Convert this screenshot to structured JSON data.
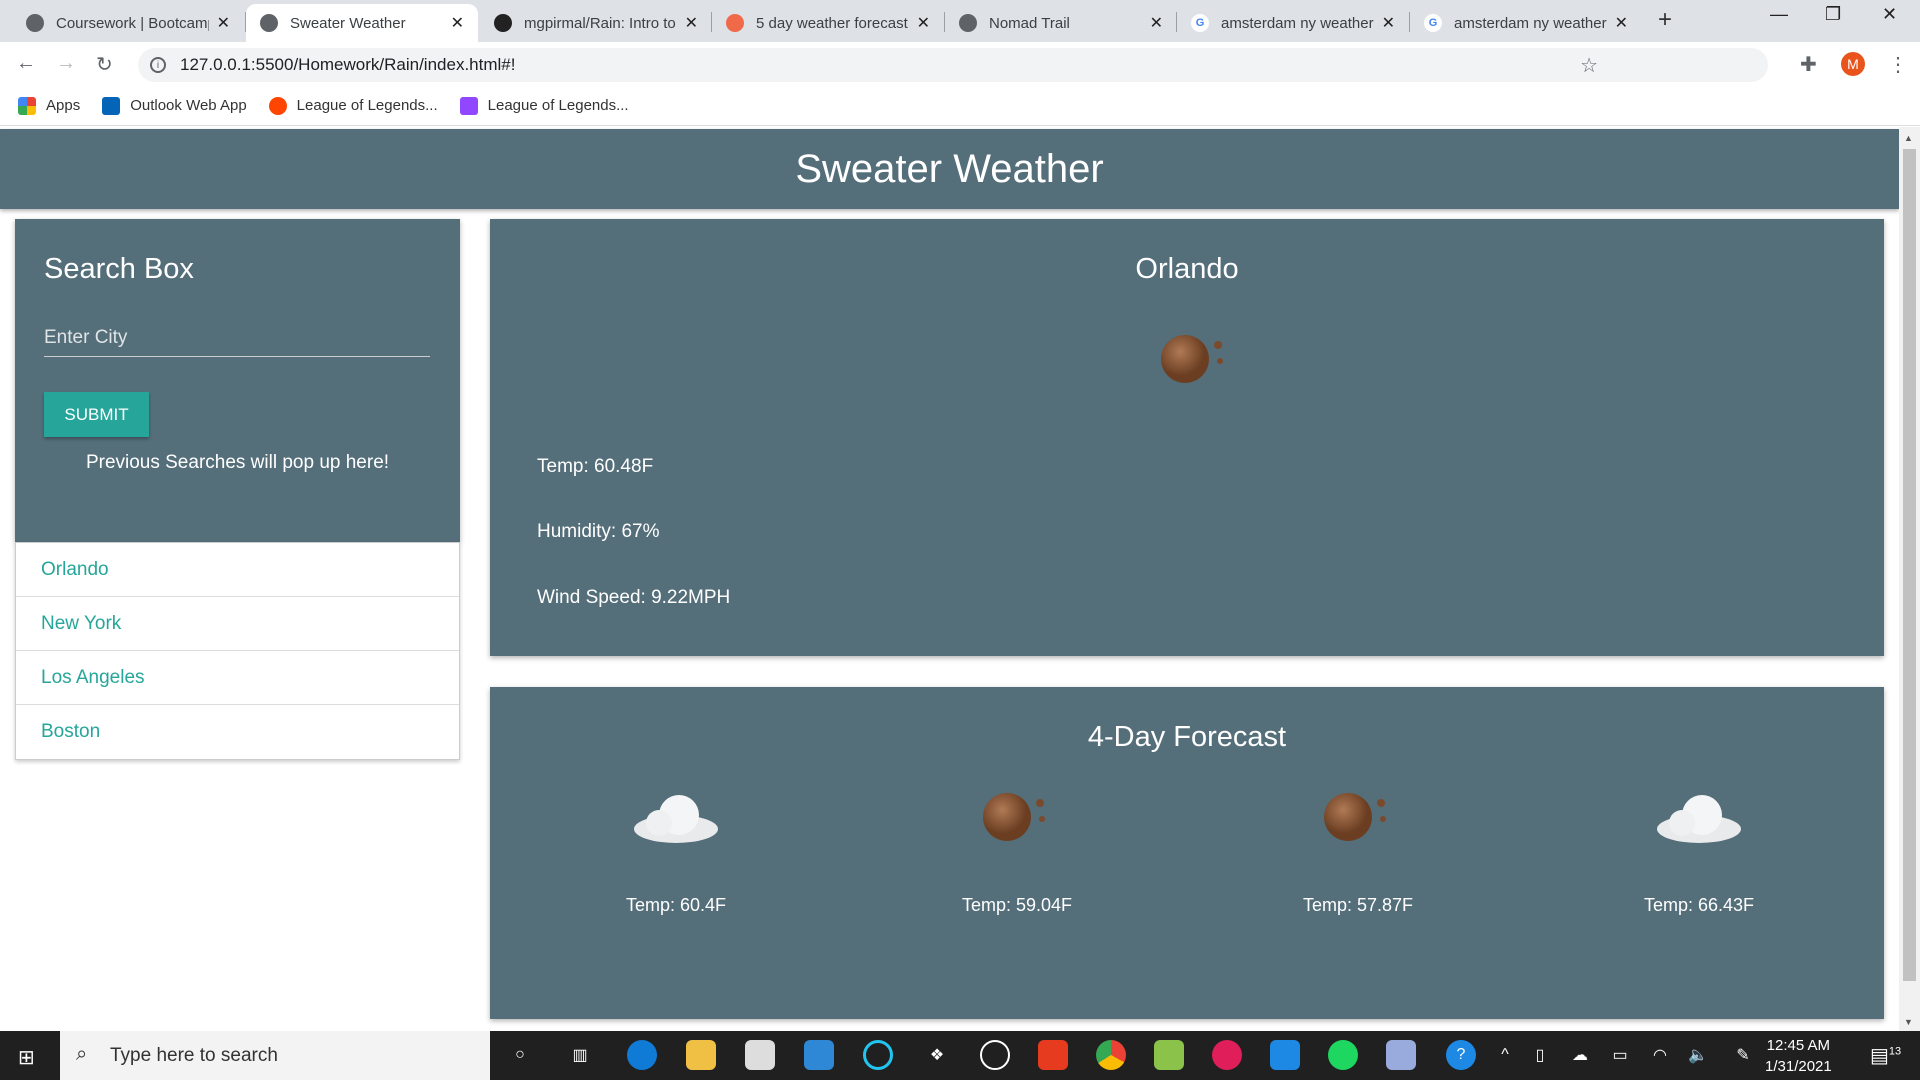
{
  "browser": {
    "tabs": [
      {
        "title": "Coursework | Bootcamp",
        "active": false
      },
      {
        "title": "Sweater Weather",
        "active": true
      },
      {
        "title": "mgpirmal/Rain: Intro to",
        "active": false
      },
      {
        "title": "5 day weather forecast",
        "active": false
      },
      {
        "title": "Nomad Trail",
        "active": false
      },
      {
        "title": "amsterdam ny weather",
        "active": false
      },
      {
        "title": "amsterdam ny weather",
        "active": false
      }
    ],
    "url": "127.0.0.1:5500/Homework/Rain/index.html#!",
    "profile_initial": "M",
    "bookmarks": [
      "Apps",
      "Outlook Web App",
      "League of Legends...",
      "League of Legends..."
    ]
  },
  "app": {
    "title": "Sweater Weather",
    "search": {
      "heading": "Search Box",
      "placeholder": "Enter City",
      "submit_label": "SUBMIT",
      "note": "Previous Searches will pop up here!"
    },
    "history": [
      "Orlando",
      "New York",
      "Los Angeles",
      "Boston"
    ],
    "current": {
      "city": "Orlando",
      "icon": "moon-clear-icon",
      "temp": "Temp: 60.48F",
      "humidity": "Humidity: 67%",
      "wind": "Wind Speed: 9.22MPH"
    },
    "forecast": {
      "title": "4-Day Forecast",
      "days": [
        {
          "icon": "cloud-icon",
          "temp": "Temp: 60.4F"
        },
        {
          "icon": "moon-clear-icon",
          "temp": "Temp: 59.04F"
        },
        {
          "icon": "moon-clear-icon",
          "temp": "Temp: 57.87F"
        },
        {
          "icon": "cloud-icon",
          "temp": "Temp: 66.43F"
        }
      ]
    }
  },
  "taskbar": {
    "search_placeholder": "Type here to search",
    "time": "12:45 AM",
    "date": "1/31/2021",
    "notifications": "13"
  },
  "colors": {
    "card": "#546e7a",
    "accent": "#26a69a"
  }
}
